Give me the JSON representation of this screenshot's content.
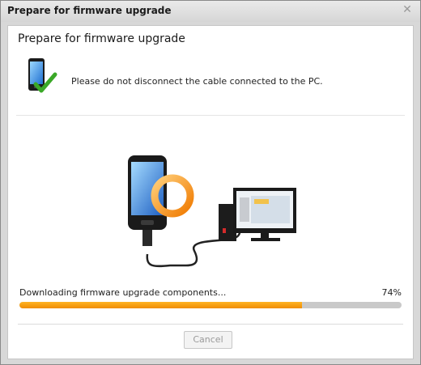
{
  "window": {
    "title": "Prepare for firmware upgrade"
  },
  "panel": {
    "heading": "Prepare for firmware upgrade",
    "status_text": "Please do not disconnect the cable connected to the PC."
  },
  "progress": {
    "label": "Downloading firmware upgrade components...",
    "percent_text": "74%",
    "value": 0.74
  },
  "buttons": {
    "cancel": "Cancel"
  },
  "icons": {
    "close": "close-icon",
    "status": "phone-checkmark-icon",
    "illustration": "phone-to-pc-connection-icon"
  },
  "colors": {
    "progress_fill": "#f08c00",
    "checkmark": "#4caf2e"
  }
}
